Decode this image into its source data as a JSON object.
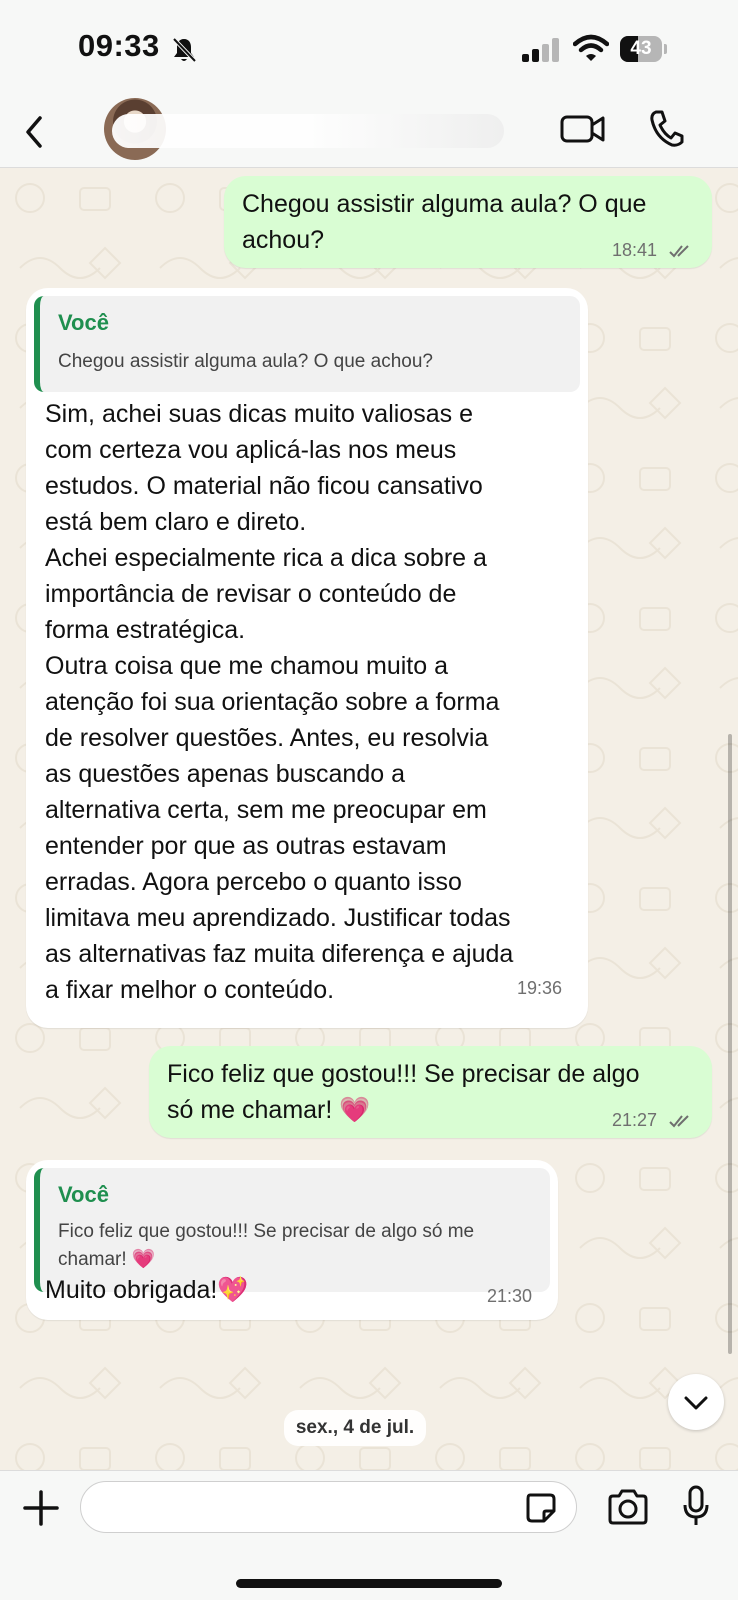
{
  "status_bar": {
    "time": "09:33",
    "battery": "43",
    "battery_level_percent": 43
  },
  "header": {
    "back_icon": "chevron-left-icon",
    "video_icon": "video-camera-icon",
    "call_icon": "phone-icon"
  },
  "messages": [
    {
      "direction": "outgoing",
      "text": "Chegou assistir alguma aula? O que\nachou?",
      "time": "18:41",
      "status": "read"
    },
    {
      "direction": "incoming",
      "quote_author": "Você",
      "quote_text": "Chegou assistir alguma aula? O que achou?",
      "text": "Sim, achei suas dicas muito valiosas e\ncom certeza vou aplicá-las nos meus\nestudos. O material não ficou cansativo\nestá bem claro e direto.\nAchei especialmente rica a dica sobre a\nimportância de revisar o conteúdo de\nforma estratégica.\nOutra coisa que me chamou muito a\natenção foi sua orientação sobre a forma\nde resolver questões. Antes, eu resolvia\nas questões apenas buscando a\nalternativa certa, sem me preocupar em\nentender por que as outras estavam\nerradas. Agora percebo o quanto isso\nlimitava meu aprendizado. Justificar todas\nas alternativas faz muita diferença e ajuda\na fixar melhor o conteúdo.",
      "time": "19:36"
    },
    {
      "direction": "outgoing",
      "text": "Fico feliz que gostou!!! Se precisar de algo\nsó me chamar! 💗",
      "time": "21:27",
      "status": "read"
    },
    {
      "direction": "incoming",
      "quote_author": "Você",
      "quote_text": "Fico feliz que gostou!!! Se precisar de algo só me\nchamar! 💗",
      "text": "Muito obrigada!💖",
      "time": "21:30"
    }
  ],
  "date_separator": "sex., 4 de jul.",
  "input_bar": {
    "placeholder": "",
    "plus_icon": "plus-icon",
    "sticker_icon": "sticker-icon",
    "camera_icon": "camera-icon",
    "mic_icon": "microphone-icon"
  },
  "colors": {
    "outgoing_bubble": "#d9fdd3",
    "incoming_bubble": "#ffffff",
    "quote_accent": "#1f8f4f",
    "chat_background": "#f4efe6"
  }
}
